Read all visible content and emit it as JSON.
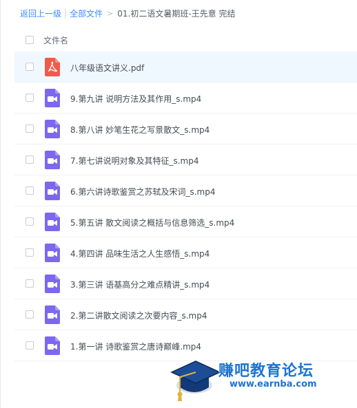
{
  "breadcrumb": {
    "back": "返回上一级",
    "separator": "|",
    "all_files": "全部文件",
    "arrow": ">",
    "current": "01.初二语文暑期班-王先意 完结"
  },
  "list_header": {
    "filename_label": "文件名"
  },
  "files": [
    {
      "name": "八年级语文讲义.pdf",
      "icon": "pdf-icon"
    },
    {
      "name": "9.第九讲 说明方法及其作用_s.mp4",
      "icon": "video-icon"
    },
    {
      "name": "8.第八讲 妙笔生花之写景散文_s.mp4",
      "icon": "video-icon"
    },
    {
      "name": "7.第七讲说明对象及其特征_s.mp4",
      "icon": "video-icon"
    },
    {
      "name": "6.第六讲诗歌鉴赏之苏轼及宋词_s.mp4",
      "icon": "video-icon"
    },
    {
      "name": "5.第五讲 散文阅读之概括与信息筛选_s.mp4",
      "icon": "video-icon"
    },
    {
      "name": "4.第四讲 品味生活之人生感悟_s.mp4",
      "icon": "video-icon"
    },
    {
      "name": "3.第三讲 语基高分之难点精讲_s.mp4",
      "icon": "video-icon"
    },
    {
      "name": "2.第二讲散文阅读之次要内容_s.mp4",
      "icon": "video-icon"
    },
    {
      "name": "1.第一讲 诗歌鉴赏之唐诗巅峰.mp4",
      "icon": "video-icon"
    }
  ],
  "watermark": {
    "brand": "赚吧教育论坛",
    "url": "www.earnba.com"
  },
  "colors": {
    "link": "#3b8cff",
    "pdf_icon": "#f05a4a",
    "video_icon": "#7b68ee",
    "row_highlight": "#f0f8ff",
    "watermark": "#1d73d0"
  }
}
